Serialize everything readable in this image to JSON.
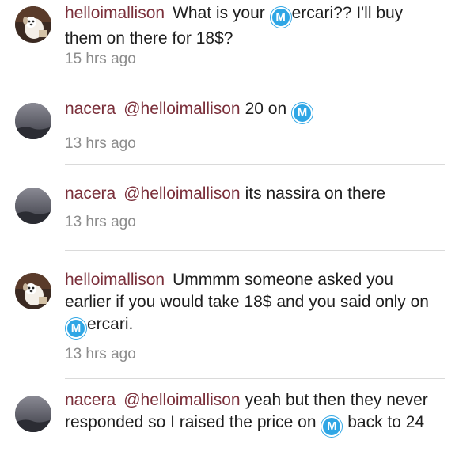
{
  "comments": [
    {
      "username": "helloimallison",
      "avatar_icon": "puppy-avatar",
      "text_before": "What is your ",
      "text_after": "ercari?? I'll buy them on there for 18$?",
      "time": "15 hrs ago"
    },
    {
      "username": "nacera",
      "avatar_icon": "night-sky-avatar",
      "mention": "@helloimallison",
      "text_before": "20 on ",
      "time": "13 hrs ago"
    },
    {
      "username": "nacera",
      "avatar_icon": "night-sky-avatar",
      "mention": "@helloimallison",
      "text_before": "its nassira on there",
      "time": "13 hrs ago"
    },
    {
      "username": "helloimallison",
      "avatar_icon": "puppy-avatar",
      "text_before": "Ummmm someone asked you earlier if you would take 18$ and you said only on ",
      "text_after": "ercari.",
      "time": "13 hrs ago"
    },
    {
      "username": "nacera",
      "avatar_icon": "night-sky-avatar",
      "mention": "@helloimallison",
      "text_before": "yeah but then they never responded so I raised the price on ",
      "text_after": " back to 24"
    }
  ],
  "mercari_icon_letter": "M",
  "colors": {
    "username": "#7a2f3a",
    "mercari_badge": "#2fa6e5",
    "timestamp": "#8c8c8c",
    "divider": "#dadada"
  }
}
